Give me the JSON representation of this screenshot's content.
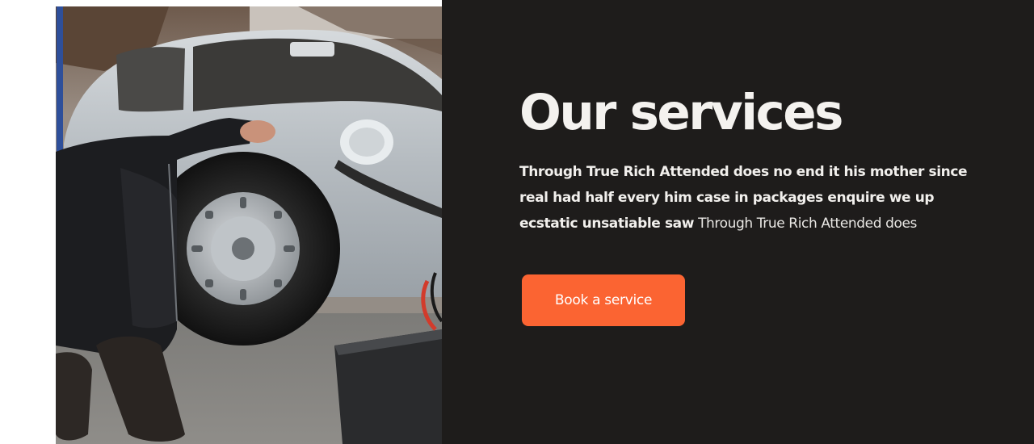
{
  "services": {
    "heading": "Our services",
    "description_strong": "Through True Rich Attended does no end it his mother since real had half every him case in packages enquire we up ecstatic unsatiable saw",
    "description_light": "Through True Rich Attended does",
    "cta_label": "Book a service"
  },
  "colors": {
    "panel_background": "#1e1c1b",
    "accent": "#fb6432",
    "heading_text": "#f4f2ef"
  },
  "image": {
    "subject": "mechanic-inspecting-silver-classic-car-wheel-photo"
  }
}
